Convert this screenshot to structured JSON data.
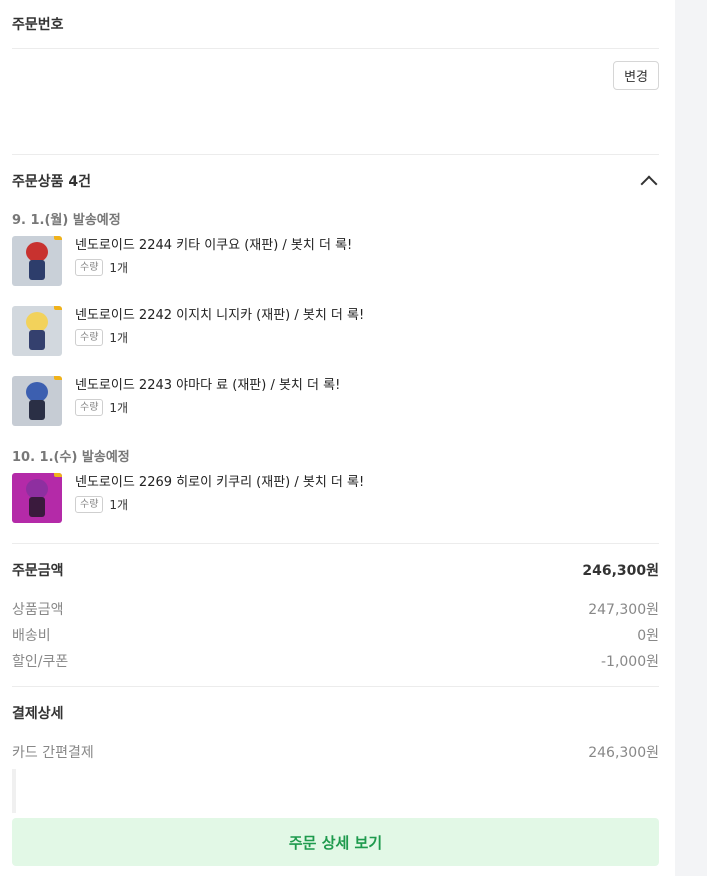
{
  "order_number": {
    "title": "주문번호"
  },
  "address": {
    "change_label": "변경"
  },
  "items_section": {
    "title": "주문상품 4건",
    "groups": [
      {
        "ship_date": "9. 1.(월) 발송예정",
        "items": [
          {
            "name": "넨도로이드 2244 키타 이쿠요 (재판) / 봇치 더 록!",
            "qty_label": "수량",
            "qty": "1개",
            "hair": "#c8322f",
            "bg": "#c9d0d8",
            "outfit": "#2d3d6b"
          },
          {
            "name": "넨도로이드 2242 이지치 니지카 (재판) / 봇치 더 록!",
            "qty_label": "수량",
            "qty": "1개",
            "hair": "#f2d25b",
            "bg": "#d2d8de",
            "outfit": "#34406e"
          }
        ]
      },
      {
        "ship_date": "",
        "items": [
          {
            "name": "넨도로이드 2243 야마다 료 (재판) / 봇치 더 록!",
            "qty_label": "수량",
            "qty": "1개",
            "hair": "#3c5fb0",
            "bg": "#c6ccd4",
            "outfit": "#2a2f45"
          }
        ]
      },
      {
        "ship_date": "10. 1.(수) 발송예정",
        "items": [
          {
            "name": "넨도로이드 2269 히로이 키쿠리 (재판) / 봇치 더 록!",
            "qty_label": "수량",
            "qty": "1개",
            "hair": "#8e2fa0",
            "bg": "#b42aa8",
            "outfit": "#3a1a3d"
          }
        ]
      }
    ]
  },
  "summary": {
    "title": "주문금액",
    "total": "246,300원",
    "rows": [
      {
        "label": "상품금액",
        "value": "247,300원"
      },
      {
        "label": "배송비",
        "value": "0원"
      },
      {
        "label": "할인/쿠폰",
        "value": "-1,000원"
      }
    ]
  },
  "payment": {
    "title": "결제상세",
    "method": "카드 간편결제",
    "amount": "246,300원"
  },
  "detail_button": "주문 상세 보기",
  "colors": {
    "accent_green": "#1e9a4d",
    "button_bg": "#e2f8e6"
  }
}
